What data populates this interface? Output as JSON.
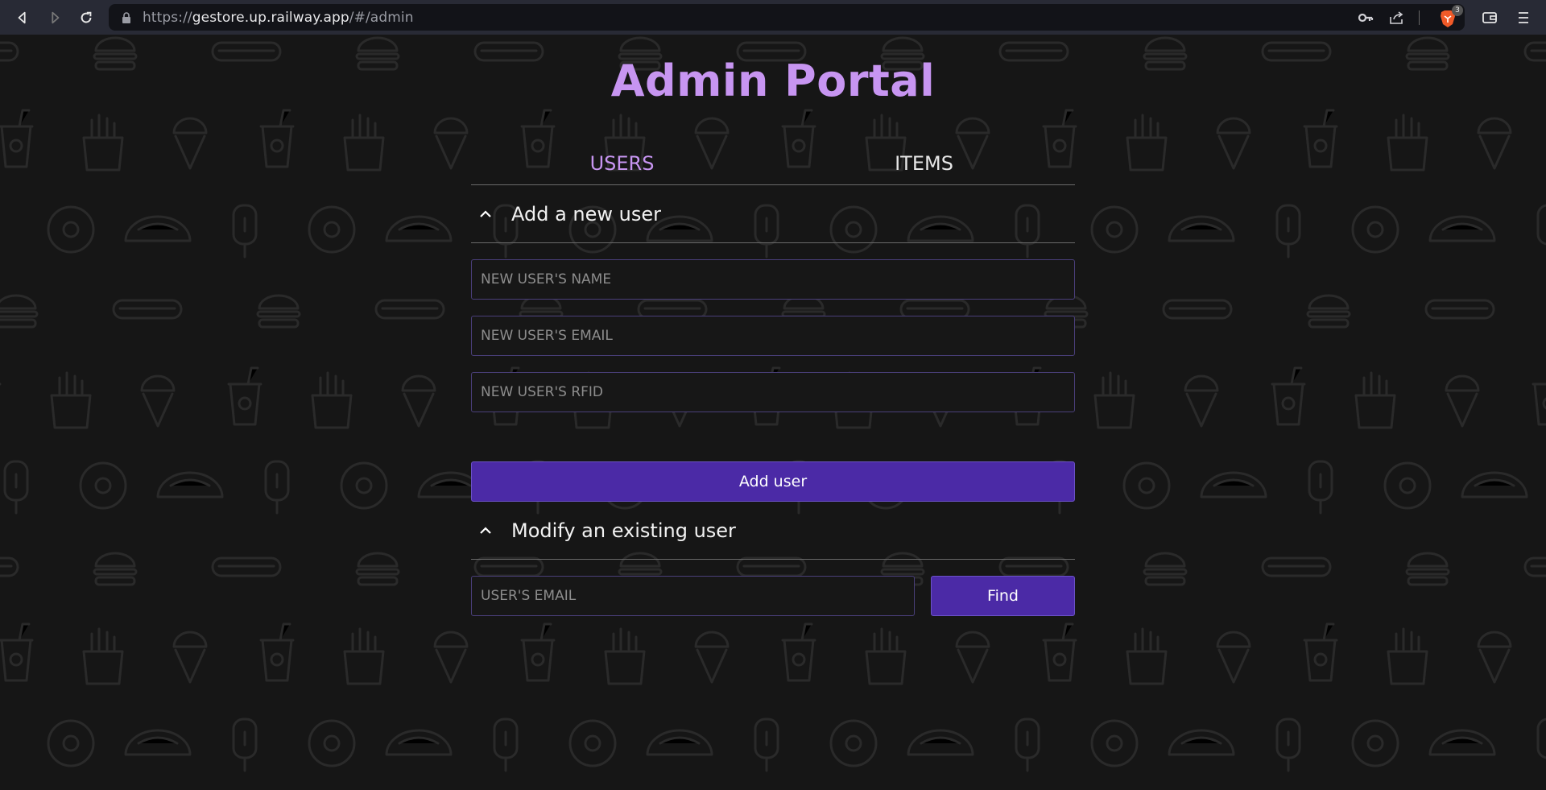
{
  "browser": {
    "url_scheme": "https://",
    "url_host": "gestore.up.railway.app",
    "url_path": "/#/admin",
    "brave_badge": "3"
  },
  "page": {
    "title": "Admin Portal",
    "tabs": [
      {
        "label": "USERS",
        "active": true
      },
      {
        "label": "ITEMS",
        "active": false
      }
    ],
    "add_section": {
      "heading": "Add a new user",
      "name_placeholder": "NEW USER'S NAME",
      "email_placeholder": "NEW USER'S EMAIL",
      "rfid_placeholder": "NEW USER'S RFID",
      "submit_label": "Add user"
    },
    "modify_section": {
      "heading": "Modify an existing user",
      "email_placeholder": "USER'S EMAIL",
      "find_label": "Find"
    }
  },
  "colors": {
    "accent": "#c795f1",
    "button": "#4b2aa6",
    "background": "#161616"
  }
}
